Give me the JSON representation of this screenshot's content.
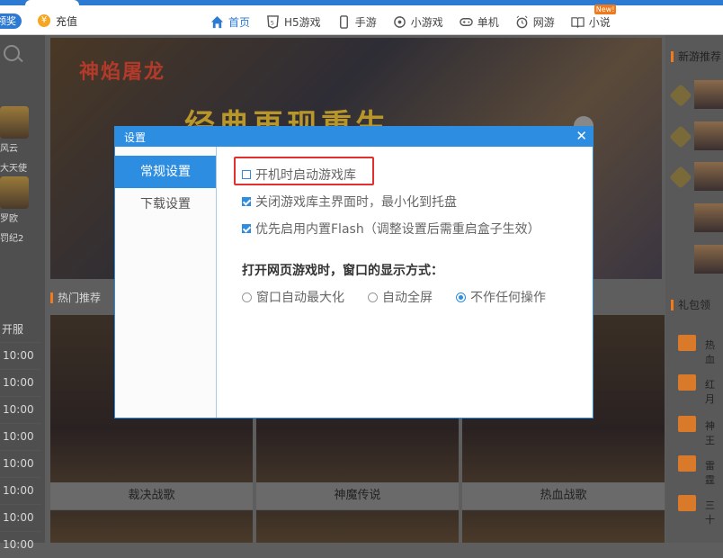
{
  "topbar": {
    "pill_label": "领奖",
    "coin_glyph": "¥",
    "recharge": "充值",
    "nav": [
      {
        "label": "首页",
        "active": true
      },
      {
        "label": "H5游戏"
      },
      {
        "label": "手游"
      },
      {
        "label": "小游戏"
      },
      {
        "label": "单机"
      },
      {
        "label": "网游"
      },
      {
        "label": "小说",
        "badge": "New!"
      }
    ]
  },
  "left": {
    "text1": "风云",
    "text2": "大天使",
    "text3": "罗欧",
    "text4": "罚纪2",
    "kaifu": "开服",
    "times": [
      "10:00",
      "10:00",
      "10:00",
      "10:00",
      "10:00",
      "10:00",
      "10:00",
      "10:00"
    ]
  },
  "banner": {
    "logo": "神焰屠龙",
    "slogan": "经典再现重生"
  },
  "hot_title": "热门推荐",
  "games": [
    "裁决战歌",
    "神魔传说",
    "热血战歌"
  ],
  "right": {
    "new_title": "新游推荐",
    "gift_title": "礼包领",
    "gifts": [
      "热血",
      "红月",
      "神王",
      "雷霆",
      "三十"
    ]
  },
  "dialog": {
    "title": "设置",
    "close": "✕",
    "tabs": [
      "常规设置",
      "下载设置"
    ],
    "options": [
      {
        "label": "开机时启动游戏库",
        "checked": false
      },
      {
        "label": "关闭游戏库主界面时，最小化到托盘",
        "checked": true
      },
      {
        "label": "优先启用内置Flash（调整设置后需重启盒子生效）",
        "checked": true
      }
    ],
    "section": "打开网页游戏时，窗口的显示方式：",
    "radios": [
      {
        "label": "窗口自动最大化",
        "selected": false
      },
      {
        "label": "自动全屏",
        "selected": false
      },
      {
        "label": "不作任何操作",
        "selected": true
      }
    ]
  }
}
